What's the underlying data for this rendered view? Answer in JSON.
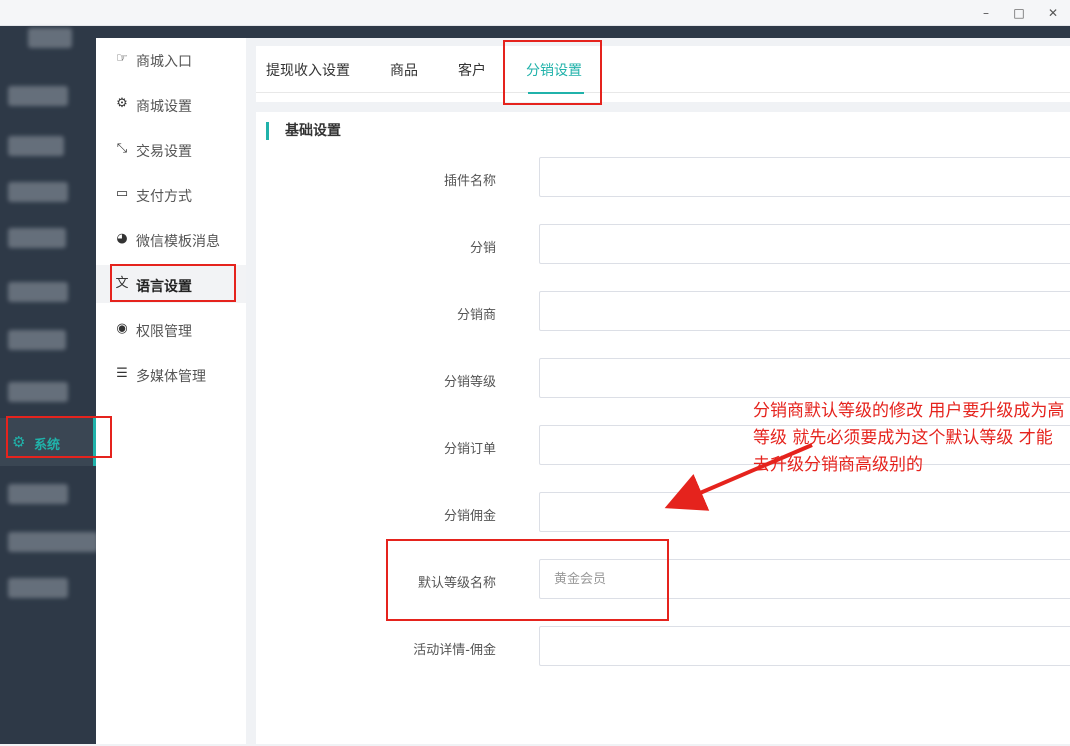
{
  "window": {
    "minimize_glyph": "–",
    "maximize_glyph": "□",
    "close_glyph": "✕"
  },
  "sidebar": {
    "active_item": {
      "label": "系统",
      "icon": "gears-icon"
    }
  },
  "submenu": {
    "items": [
      {
        "label": "商城入口",
        "icon": "hand-pointer-icon",
        "glyph": "☞"
      },
      {
        "label": "商城设置",
        "icon": "gear-icon",
        "glyph": "⚙"
      },
      {
        "label": "交易设置",
        "icon": "compress-icon",
        "glyph": "⤡"
      },
      {
        "label": "支付方式",
        "icon": "credit-card-icon",
        "glyph": "▭"
      },
      {
        "label": "微信模板消息",
        "icon": "wechat-icon",
        "glyph": "◕"
      },
      {
        "label": "语言设置",
        "icon": "language-icon",
        "glyph": "文"
      },
      {
        "label": "权限管理",
        "icon": "gamepad-icon",
        "glyph": "◉"
      },
      {
        "label": "多媒体管理",
        "icon": "list-icon",
        "glyph": "☰"
      }
    ],
    "active_index": 5
  },
  "tabs": {
    "items": [
      "提现收入设置",
      "商品",
      "客户",
      "分销设置"
    ],
    "active_index": 3
  },
  "form": {
    "section_title": "基础设置",
    "fields": [
      {
        "label": "插件名称",
        "value": ""
      },
      {
        "label": "分销",
        "value": ""
      },
      {
        "label": "分销商",
        "value": ""
      },
      {
        "label": "分销等级",
        "value": ""
      },
      {
        "label": "分销订单",
        "value": ""
      },
      {
        "label": "分销佣金",
        "value": ""
      },
      {
        "label": "默认等级名称",
        "value": "黄金会员"
      },
      {
        "label": "活动详情-佣金",
        "value": ""
      }
    ]
  },
  "annotation": {
    "text": "分销商默认等级的修改  用户要升级成为高等级 就先必须要成为这个默认等级 才能去升级分销商高级别的"
  },
  "colors": {
    "accent": "#20b2aa",
    "sidebar_dark": "#2e3947",
    "annotation_red": "#e5231d"
  }
}
